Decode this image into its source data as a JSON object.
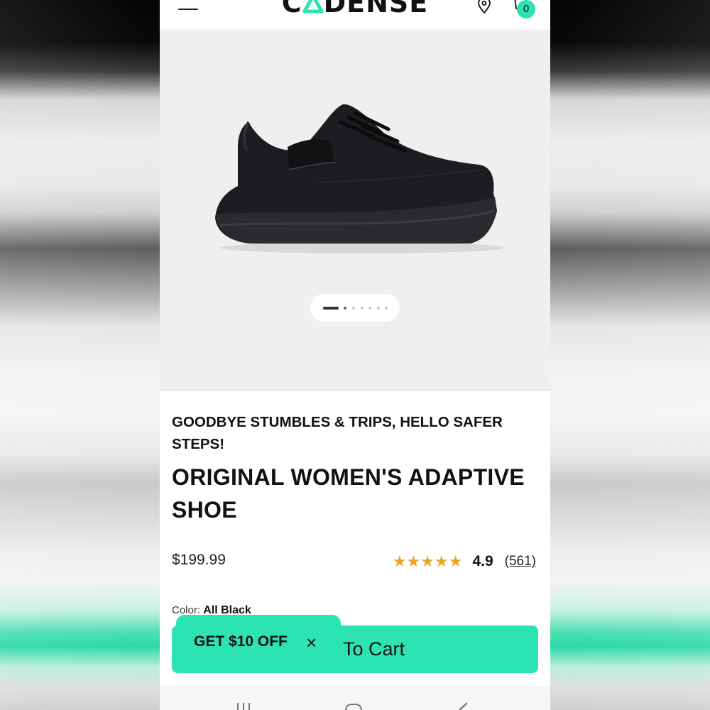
{
  "header": {
    "logo_prefix": "C",
    "logo_mark": "A",
    "logo_suffix": "DENSE",
    "cart_count": "0",
    "icons": [
      "menu-icon",
      "location-pin-icon",
      "cart-icon"
    ]
  },
  "gallery": {
    "image_count": 7,
    "active_index": 0
  },
  "product": {
    "tagline": "GOODBYE STUMBLES & TRIPS, HELLO SAFER STEPS!",
    "title": "ORIGINAL WOMEN'S ADAPTIVE SHOE",
    "price": "$199.99",
    "stars": "★★★★★",
    "rating": "4.9",
    "review_count": "(561)",
    "color_label": "Color:",
    "color_value": "All Black"
  },
  "actions": {
    "add_to_cart_label": "To Cart",
    "promo_text": "GET $10 OFF",
    "promo_close": "×"
  },
  "colors": {
    "accent": "#2ce3b3",
    "star": "#f0a324",
    "text": "#111111"
  }
}
